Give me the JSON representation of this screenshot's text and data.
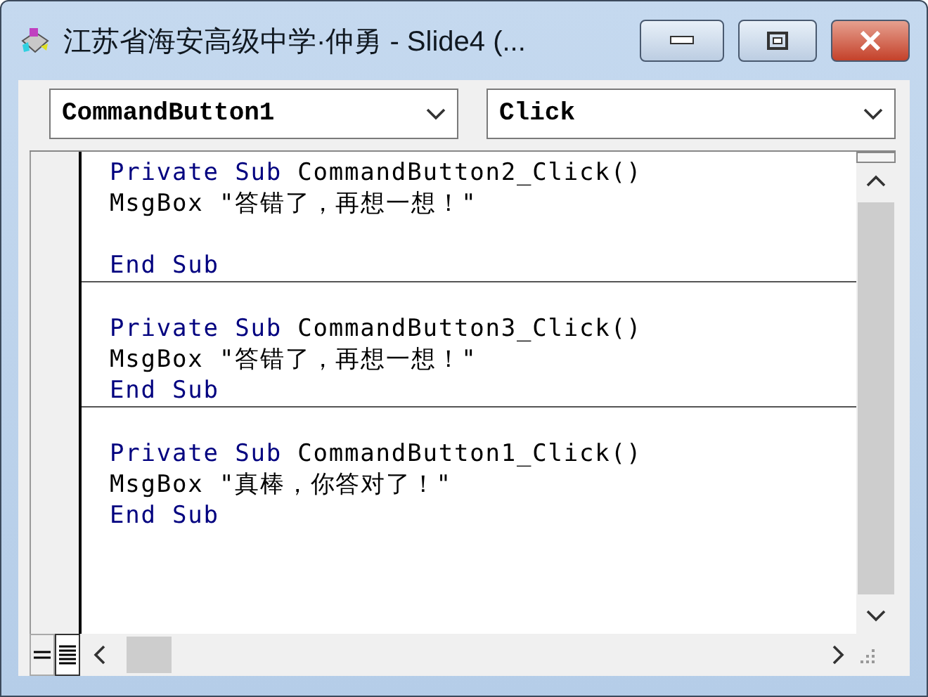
{
  "window": {
    "title": "江苏省海安高级中学·仲勇 - Slide4 (..."
  },
  "object_dropdown": {
    "value": "CommandButton1"
  },
  "procedure_dropdown": {
    "value": "Click"
  },
  "procedures": [
    {
      "lines": [
        {
          "kind": "code",
          "tokens": [
            {
              "text": "Private Sub",
              "kind": "keyword"
            },
            {
              "text": " CommandButton2_Click()",
              "kind": "plain"
            }
          ]
        },
        {
          "kind": "code",
          "tokens": [
            {
              "text": "MsgBox \"答错了，再想一想！\"",
              "kind": "plain"
            }
          ]
        },
        {
          "kind": "blank"
        },
        {
          "kind": "code",
          "tokens": [
            {
              "text": "End Sub",
              "kind": "keyword"
            }
          ]
        }
      ]
    },
    {
      "lines": [
        {
          "kind": "code",
          "tokens": [
            {
              "text": "Private Sub",
              "kind": "keyword"
            },
            {
              "text": " CommandButton3_Click()",
              "kind": "plain"
            }
          ]
        },
        {
          "kind": "code",
          "tokens": [
            {
              "text": "MsgBox \"答错了，再想一想！\"",
              "kind": "plain"
            }
          ]
        },
        {
          "kind": "code",
          "tokens": [
            {
              "text": "End Sub",
              "kind": "keyword"
            }
          ]
        }
      ]
    },
    {
      "lines": [
        {
          "kind": "code",
          "tokens": [
            {
              "text": "Private Sub",
              "kind": "keyword"
            },
            {
              "text": " CommandButton1_Click()",
              "kind": "plain"
            }
          ]
        },
        {
          "kind": "code",
          "tokens": [
            {
              "text": "MsgBox \"真棒，你答对了！\"",
              "kind": "plain"
            }
          ]
        },
        {
          "kind": "code",
          "tokens": [
            {
              "text": "End Sub",
              "kind": "keyword"
            }
          ]
        }
      ]
    }
  ],
  "view_buttons": [
    {
      "kind": "procedure",
      "selected": false
    },
    {
      "kind": "module",
      "selected": true
    }
  ]
}
